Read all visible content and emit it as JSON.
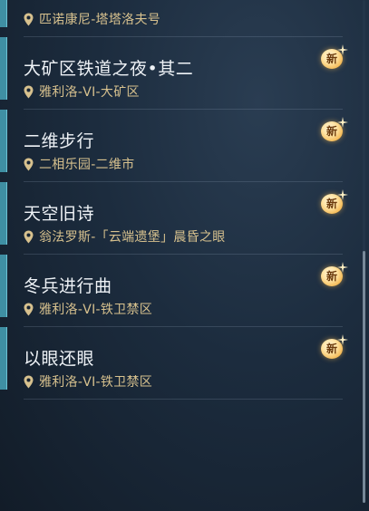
{
  "quest_list": {
    "items": [
      {
        "title": "",
        "location": "匹诺康尼-塔塔洛夫号",
        "is_new": false
      },
      {
        "title": "大矿区铁道之夜•其二",
        "location": "雅利洛-VI-大矿区",
        "is_new": true
      },
      {
        "title": "二维步行",
        "location": "二相乐园-二维市",
        "is_new": true
      },
      {
        "title": "天空旧诗",
        "location": "翁法罗斯-「云端遗堡」晨昏之眼",
        "is_new": true
      },
      {
        "title": "冬兵进行曲",
        "location": "雅利洛-VI-铁卫禁区",
        "is_new": true
      },
      {
        "title": "以眼还眼",
        "location": "雅利洛-VI-铁卫禁区",
        "is_new": true
      }
    ]
  },
  "new_badge_label": "新",
  "scroll": {
    "position_fraction": 0.5,
    "visible_fraction": 0.5
  },
  "colors": {
    "accent_bar": "#3f8fa3",
    "location_text": "#d7c18e",
    "title_text": "#eef2f6",
    "badge_gold": "#f2b349"
  },
  "icons": {
    "location": "map-pin-icon",
    "new": "new-badge-icon",
    "sparkle": "sparkle-icon"
  }
}
